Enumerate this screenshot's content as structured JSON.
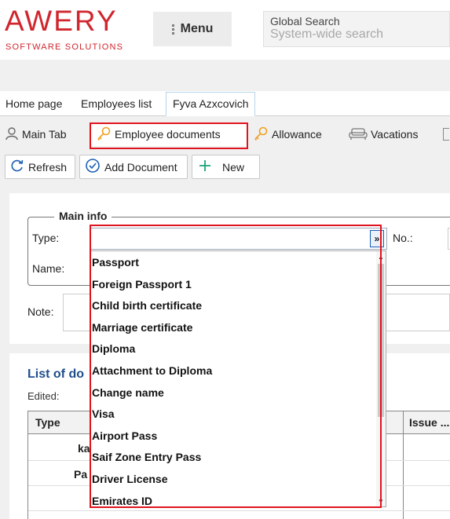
{
  "header": {
    "logo_word": "AWERY",
    "logo_sub": "SOFTWARE SOLUTIONS",
    "menu_label": "Menu",
    "global_search_label": "Global Search",
    "global_search_placeholder": "System-wide search"
  },
  "breadcrumbs": [
    {
      "label": "Home page"
    },
    {
      "label": "Employees list"
    },
    {
      "label": "Fyva Azxcovich"
    }
  ],
  "subtabs": [
    {
      "label": "Main Tab",
      "icon": "user-icon"
    },
    {
      "label": "Employee documents",
      "icon": "key-icon"
    },
    {
      "label": "Allowance",
      "icon": "key-icon"
    },
    {
      "label": "Vacations",
      "icon": "sofa-icon"
    }
  ],
  "toolbar": {
    "refresh_label": "Refresh",
    "add_document_label": "Add Document",
    "new_label": "New"
  },
  "main_info": {
    "legend": "Main info",
    "type_label": "Type:",
    "no_label": "No.:",
    "name_label": "Name:",
    "note_label": "Note:",
    "type_value": ""
  },
  "list": {
    "title": "List of do",
    "edited_label": "Edited:",
    "columns": [
      "Type",
      "Issue ..."
    ],
    "rows": [
      "ka",
      "Pa"
    ]
  },
  "dropdown": {
    "options": [
      "Passport",
      "Foreign Passport 1",
      "Child birth certificate",
      "Marriage certificate",
      "Diploma",
      "Attachment to Diploma",
      "Change name",
      "Visa",
      "Airport Pass",
      "Saif Zone Entry Pass",
      "Driver License",
      "Emirates ID"
    ]
  },
  "colors": {
    "brand": "#d0262e",
    "highlight": "#e0141e",
    "link_title": "#1f4e8c",
    "key_icon": "#f0a020"
  }
}
